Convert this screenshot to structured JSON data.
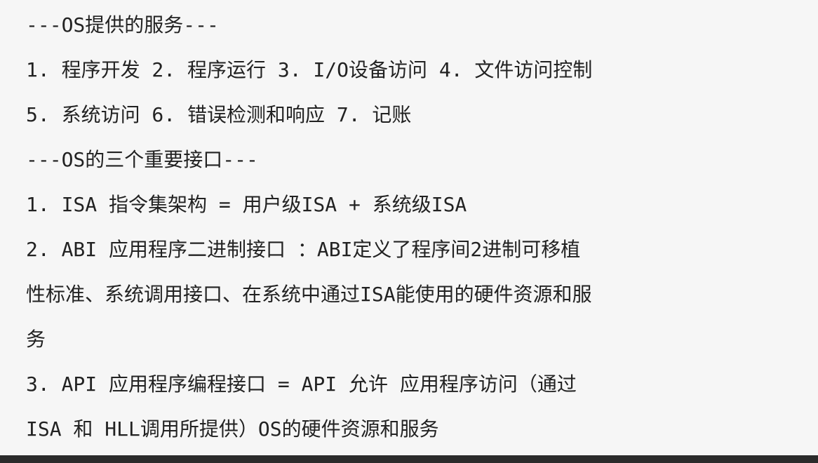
{
  "document": {
    "lines": [
      "---OS提供的服务---",
      "1. 程序开发 2. 程序运行 3. I/O设备访问 4. 文件访问控制",
      "5. 系统访问 6. 错误检测和响应 7. 记账",
      "---OS的三个重要接口---",
      "1. ISA 指令集架构 = 用户级ISA + 系统级ISA",
      "2. ABI 应用程序二进制接口 ：ABI定义了程序间2进制可移植",
      "性标准、系统调用接口、在系统中通过ISA能使用的硬件资源和服",
      "务",
      "3. API 应用程序编程接口 = API 允许 应用程序访问（通过",
      "ISA 和 HLL调用所提供）OS的硬件资源和服务"
    ]
  }
}
